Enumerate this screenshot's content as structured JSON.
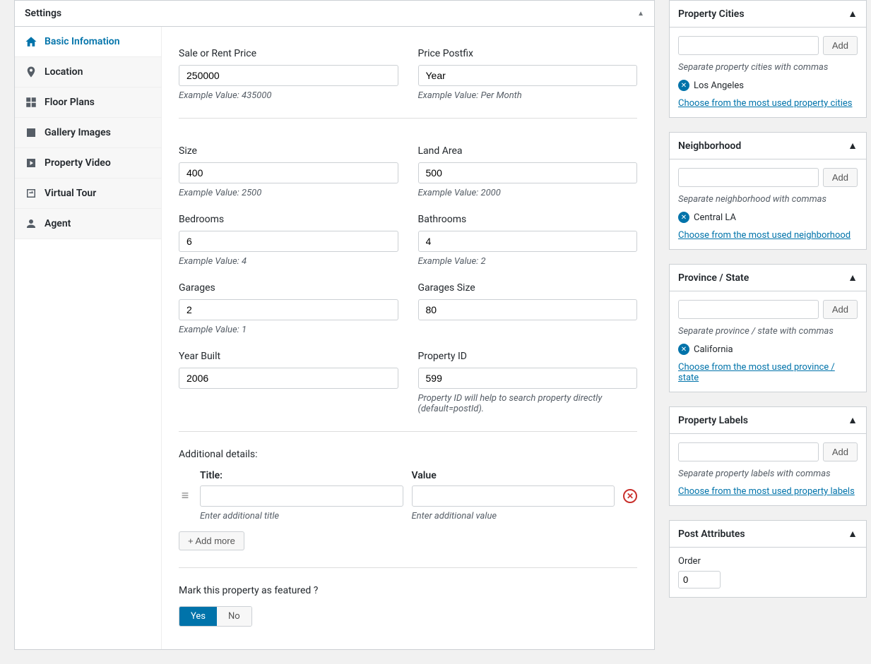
{
  "settings": {
    "title": "Settings",
    "tabs": [
      {
        "label": "Basic Infomation"
      },
      {
        "label": "Location"
      },
      {
        "label": "Floor Plans"
      },
      {
        "label": "Gallery Images"
      },
      {
        "label": "Property Video"
      },
      {
        "label": "Virtual Tour"
      },
      {
        "label": "Agent"
      }
    ]
  },
  "fields": {
    "price": {
      "label": "Sale or Rent Price",
      "value": "250000",
      "hint": "Example Value: 435000"
    },
    "postfix": {
      "label": "Price Postfix",
      "value": "Year",
      "hint": "Example Value: Per Month"
    },
    "size": {
      "label": "Size",
      "value": "400",
      "hint": "Example Value: 2500"
    },
    "land_area": {
      "label": "Land Area",
      "value": "500",
      "hint": "Example Value: 2000"
    },
    "bedrooms": {
      "label": "Bedrooms",
      "value": "6",
      "hint": "Example Value: 4"
    },
    "bathrooms": {
      "label": "Bathrooms",
      "value": "4",
      "hint": "Example Value: 2"
    },
    "garages": {
      "label": "Garages",
      "value": "2",
      "hint": "Example Value: 1"
    },
    "garages_size": {
      "label": "Garages Size",
      "value": "80",
      "hint": ""
    },
    "year_built": {
      "label": "Year Built",
      "value": "2006",
      "hint": ""
    },
    "property_id": {
      "label": "Property ID",
      "value": "599",
      "hint": "Property ID will help to search property directly (default=postId)."
    }
  },
  "additional": {
    "section_label": "Additional details:",
    "title_col": "Title:",
    "value_col": "Value",
    "title_hint": "Enter additional title",
    "value_hint": "Enter additional value",
    "add_more": "+ Add more"
  },
  "featured": {
    "label": "Mark this property as featured ?",
    "yes": "Yes",
    "no": "No"
  },
  "side": {
    "add": "Add",
    "cities": {
      "title": "Property Cities",
      "hint": "Separate property cities with commas",
      "tag": "Los Angeles",
      "link": "Choose from the most used property cities"
    },
    "neighborhood": {
      "title": "Neighborhood",
      "hint": "Separate neighborhood with commas",
      "tag": "Central LA",
      "link": "Choose from the most used neighborhood"
    },
    "province": {
      "title": "Province / State",
      "hint": "Separate province / state with commas",
      "tag": "California",
      "link": "Choose from the most used province / state"
    },
    "labels": {
      "title": "Property Labels",
      "hint": "Separate property labels with commas",
      "link": "Choose from the most used property labels"
    },
    "attrs": {
      "title": "Post Attributes",
      "order_label": "Order",
      "order_value": "0"
    }
  }
}
